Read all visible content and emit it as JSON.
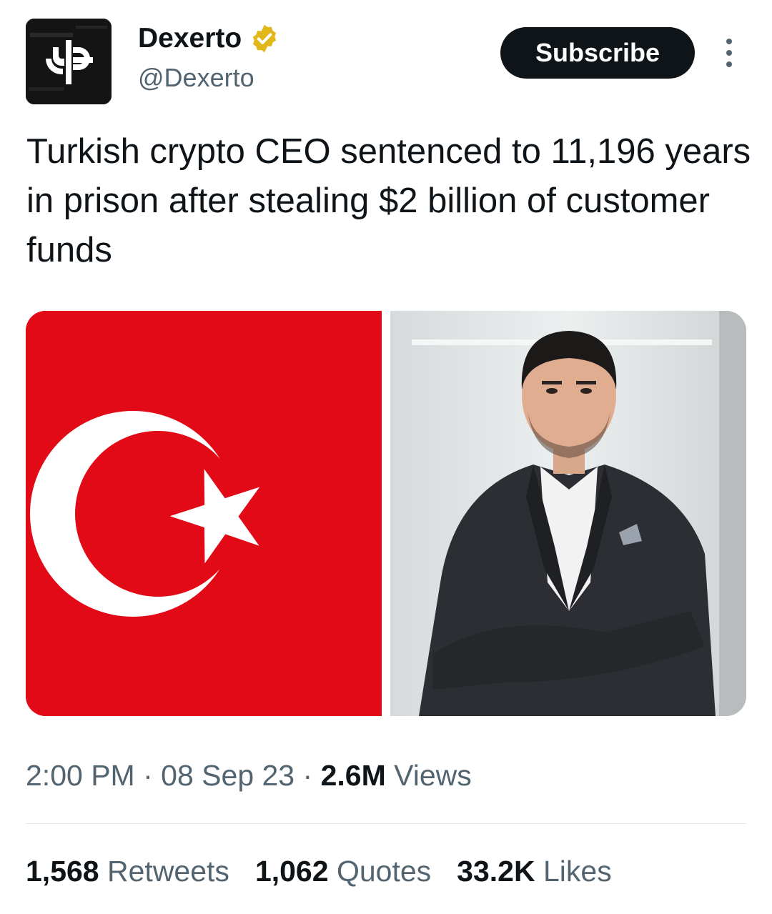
{
  "author": {
    "name": "Dexerto",
    "handle": "@Dexerto",
    "avatar_icon": "dexerto-logo-icon",
    "verified_icon": "verified-badge-icon",
    "verified_color": "#e2b719"
  },
  "actions": {
    "subscribe_label": "Subscribe",
    "more_icon": "more-vertical-icon"
  },
  "tweet": {
    "text": "Turkish crypto CEO sentenced to 11,196 years in prison after stealing $2 billion of customer funds"
  },
  "media": [
    {
      "description_icon": "turkey-flag-image",
      "flag_color": "#e30a17"
    },
    {
      "description_icon": "man-in-suit-photo"
    }
  ],
  "meta": {
    "time": "2:00 PM",
    "separator": "·",
    "date": "08 Sep 23",
    "views_count": "2.6M",
    "views_label": "Views"
  },
  "stats": [
    {
      "count": "1,568",
      "label": "Retweets"
    },
    {
      "count": "1,062",
      "label": "Quotes"
    },
    {
      "count": "33.2K",
      "label": "Likes"
    }
  ]
}
